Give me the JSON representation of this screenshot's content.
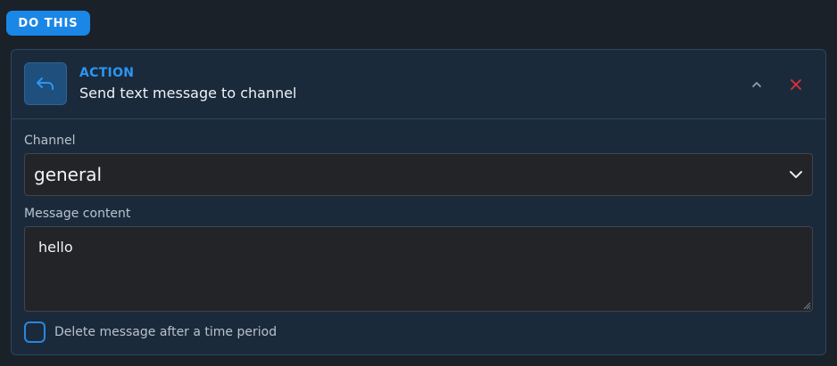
{
  "top_button": {
    "label": "DO THIS"
  },
  "action_card": {
    "kicker": "ACTION",
    "title": "Send text message to channel",
    "icon": "reply-arrow-icon",
    "collapse_icon": "chevron-up-icon",
    "close_icon": "close-icon",
    "colors": {
      "accent": "#2a96f2",
      "close": "#e0303a",
      "card_bg": "#1b2a3b"
    }
  },
  "form": {
    "channel": {
      "label": "Channel",
      "value": "general"
    },
    "message": {
      "label": "Message content",
      "value": "hello"
    },
    "delete_after": {
      "label": "Delete message after a time period",
      "checked": false
    }
  }
}
